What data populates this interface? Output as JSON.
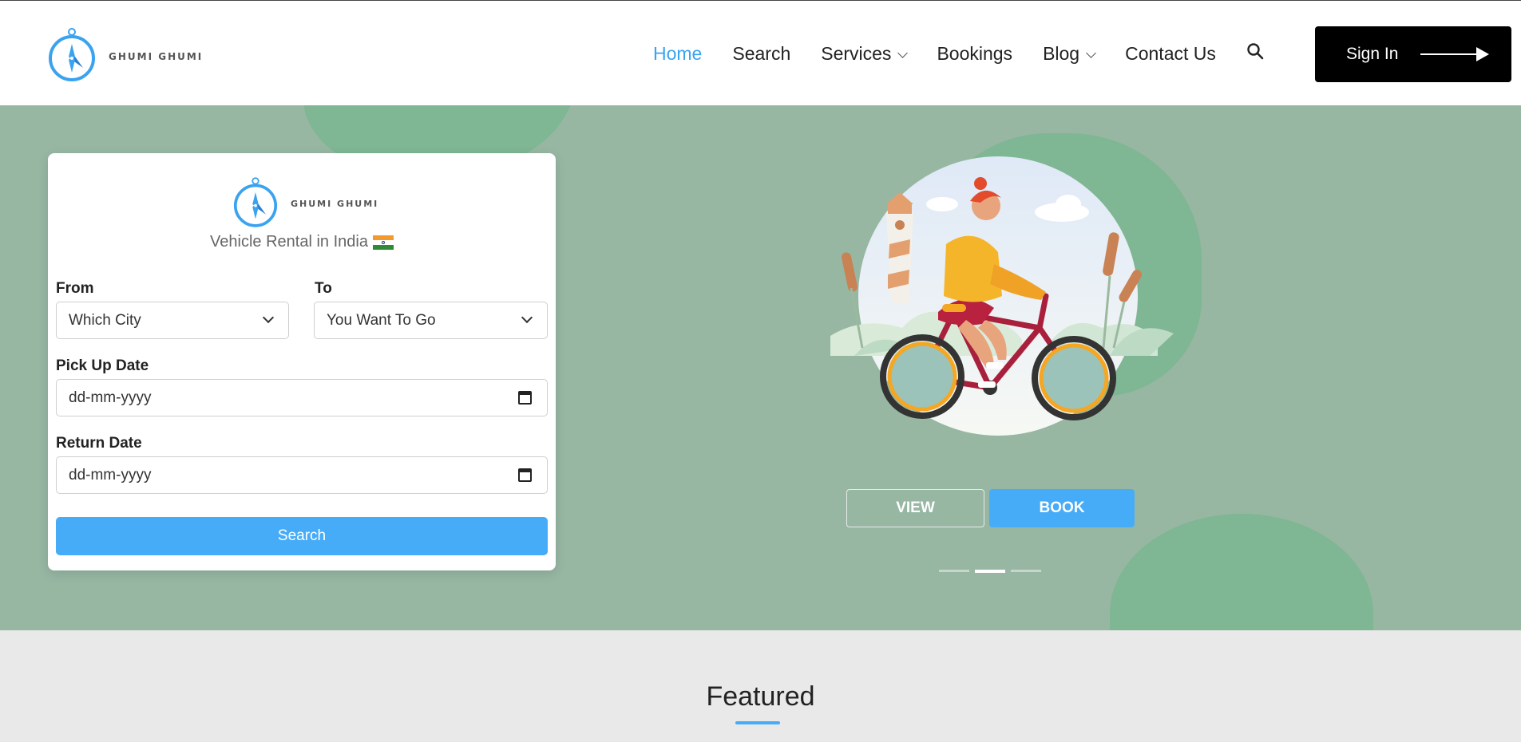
{
  "brand": {
    "name": "GHUMI GHUMI"
  },
  "nav": {
    "items": [
      {
        "label": "Home",
        "active": true
      },
      {
        "label": "Search"
      },
      {
        "label": "Services",
        "dropdown": true
      },
      {
        "label": "Bookings"
      },
      {
        "label": "Blog",
        "dropdown": true
      },
      {
        "label": "Contact Us"
      }
    ],
    "signin_label": "Sign In"
  },
  "form": {
    "tagline": "Vehicle Rental in India",
    "from_label": "From",
    "from_value": "Which City",
    "to_label": "To",
    "to_value": "You Want To Go",
    "pickup_label": "Pick Up Date",
    "pickup_placeholder": "dd-mm-yyyy",
    "return_label": "Return Date",
    "return_placeholder": "dd-mm-yyyy",
    "submit_label": "Search"
  },
  "hero": {
    "view_label": "VIEW",
    "book_label": "BOOK",
    "carousel_active_index": 1
  },
  "featured": {
    "title": "Featured"
  },
  "colors": {
    "accent": "#47acf8",
    "hero_bg": "#97b7a3",
    "blob": "#7fb693"
  }
}
